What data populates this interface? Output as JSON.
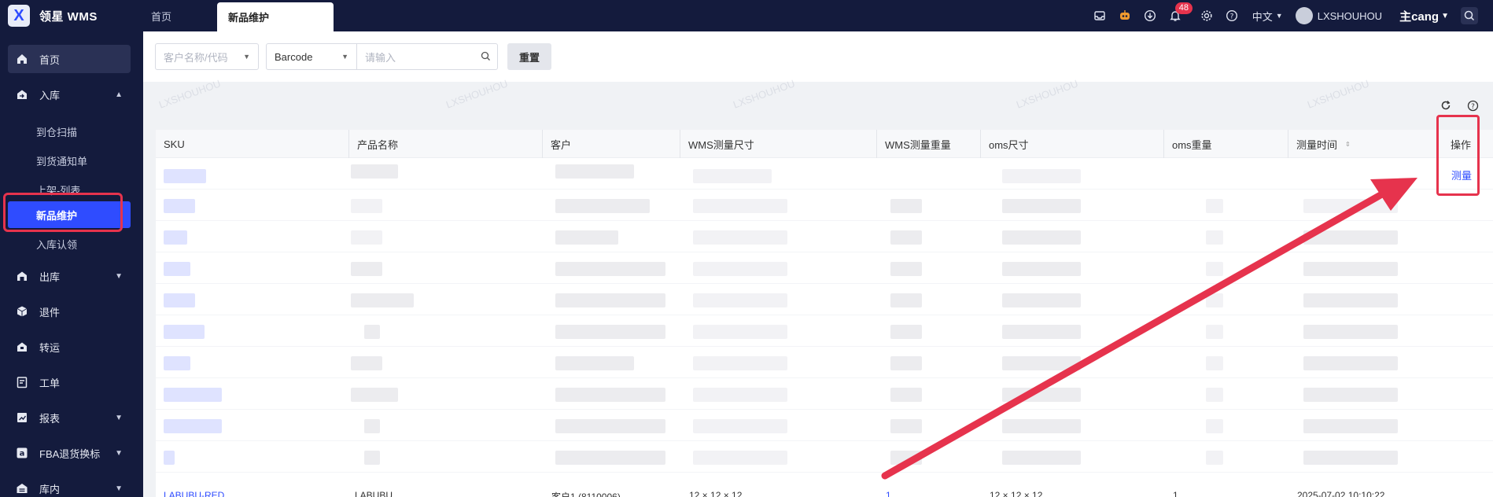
{
  "app": {
    "logo_letter": "X",
    "name": "领星 WMS"
  },
  "tabs": [
    {
      "label": "首页"
    },
    {
      "label": "新品维护",
      "active": true
    }
  ],
  "header": {
    "notification_count": "48",
    "language": "中文",
    "username": "LXSHOUHOU",
    "warehouse": "主cang",
    "icons": [
      "inbox-icon",
      "robot-icon",
      "download-icon",
      "bell-icon",
      "gear-icon",
      "help-icon"
    ]
  },
  "sidebar": {
    "items": [
      {
        "label": "首页",
        "icon": "home-icon"
      },
      {
        "label": "入库",
        "icon": "inbound-icon",
        "expanded": true
      },
      {
        "label": "出库",
        "icon": "outbound-icon"
      },
      {
        "label": "退件",
        "icon": "return-icon"
      },
      {
        "label": "转运",
        "icon": "transfer-icon"
      },
      {
        "label": "工单",
        "icon": "workorder-icon"
      },
      {
        "label": "报表",
        "icon": "report-icon"
      },
      {
        "label": "FBA退货换标",
        "icon": "amazon-icon"
      },
      {
        "label": "库内",
        "icon": "warehouse-icon"
      }
    ],
    "sub_items": [
      {
        "label": "到仓扫描"
      },
      {
        "label": "到货通知单"
      },
      {
        "label": "上架-列表"
      },
      {
        "label": "新品维护",
        "active": true
      },
      {
        "label": "入库认领"
      }
    ]
  },
  "filters": {
    "customer_placeholder": "客户名称/代码",
    "barcode_type": "Barcode",
    "search_placeholder": "请输入",
    "reset_label": "重置"
  },
  "table": {
    "columns": [
      "SKU",
      "产品名称",
      "客户",
      "WMS测量尺寸",
      "WMS测量重量",
      "oms尺寸",
      "oms重量",
      "测量时间",
      "操作"
    ],
    "action_label": "测量",
    "partial_row": {
      "sku": "LABUBU-RED",
      "name": "LABUBU",
      "customer": "客户1 (8110006)",
      "wms_size": "12 × 12 × 12",
      "wms_weight": "1",
      "oms_size": "12 × 12 × 12",
      "oms_weight": "1",
      "time": "2025-07-02 10:10:22"
    }
  },
  "colors": {
    "accent": "#2f4cff",
    "nav_bg": "#141b3d",
    "annotation": "#e6334d"
  }
}
